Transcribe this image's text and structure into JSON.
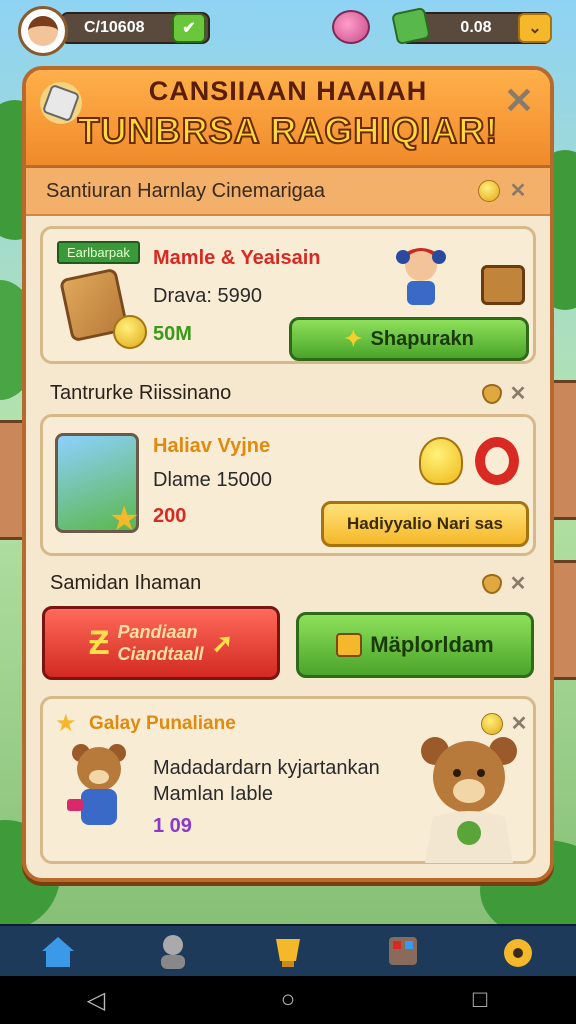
{
  "topbar": {
    "left_value": "C/10608",
    "right_value": "0.08",
    "left_action_icon": "check-arrow-icon",
    "right_action_icon": "chevron-down-icon"
  },
  "panel": {
    "title_line1": "CANSIIAAN HAAIAH",
    "title_line2": "TUNBRSA RAGHIQIAR!",
    "subheader": "Santiuran Harnlay Cinemarigaa"
  },
  "card1": {
    "tag": "Earlbarpak",
    "title": "Mamle & Yeaisain",
    "line": "Drava: 5990",
    "amount": "50M",
    "button_label": "Shapurakn"
  },
  "section2": {
    "label": "Tantrurke Riissinano"
  },
  "card2": {
    "title": "Haliav Vyjne",
    "line": "Dlame 15000",
    "amount": "200",
    "button_label": "Hadiyyalio Nari sas"
  },
  "section3": {
    "label": "Samidan Ihaman"
  },
  "action_buttons": {
    "red_line1": "Pandiaan",
    "red_line2": "Ciandtaall",
    "green_label": "Mäplorldam"
  },
  "card3": {
    "title": "Galay Punaliane",
    "line1": "Madadardarn kyjartankan",
    "line2": "Mamlan Iable",
    "amount": "1 09"
  },
  "colors": {
    "header_orange": "#f08a2a",
    "green_button": "#4aa52a",
    "yellow_button": "#f5b82a",
    "red_button": "#d22a22",
    "title_yellow": "#ffd83a"
  }
}
